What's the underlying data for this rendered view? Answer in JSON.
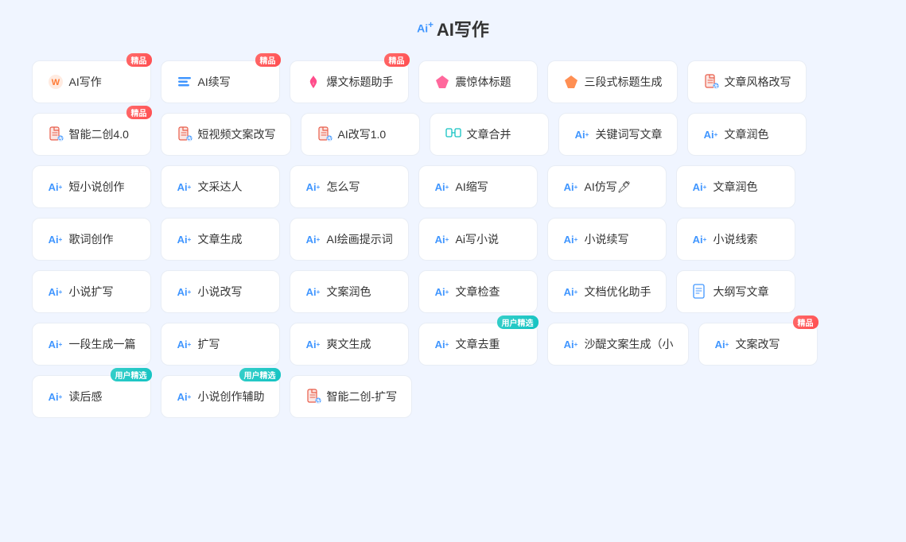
{
  "page": {
    "title": "AI写作",
    "title_prefix": "Ai⁺"
  },
  "rows": [
    {
      "cards": [
        {
          "id": "ai-writing",
          "icon_type": "circle-w",
          "icon_color": "c-orange",
          "label": "AI写作",
          "badge": "精品"
        },
        {
          "id": "ai-continue",
          "icon_type": "lines",
          "icon_color": "c-blue",
          "label": "AI续写",
          "badge": "精品"
        },
        {
          "id": "hot-title",
          "icon_type": "flame",
          "icon_color": "c-pink",
          "label": "爆文标题助手",
          "badge": "精品"
        },
        {
          "id": "shock-title",
          "icon_type": "diamond",
          "icon_color": "c-pink",
          "label": "震惊体标题",
          "badge": ""
        },
        {
          "id": "three-para-title",
          "icon_type": "diamond",
          "icon_color": "c-orange",
          "label": "三段式标题生成",
          "badge": ""
        },
        {
          "id": "style-rewrite",
          "icon_type": "doc",
          "icon_color": "c-red",
          "label": "文章风格改写",
          "badge": ""
        }
      ]
    },
    {
      "cards": [
        {
          "id": "smart-dual",
          "icon_type": "doc",
          "icon_color": "c-red",
          "label": "智能二创4.0",
          "badge": "精品"
        },
        {
          "id": "short-video",
          "icon_type": "doc",
          "icon_color": "c-red",
          "label": "短视频文案改写",
          "badge": ""
        },
        {
          "id": "ai-rewrite",
          "icon_type": "doc",
          "icon_color": "c-red",
          "label": "AI改写1.0",
          "badge": ""
        },
        {
          "id": "article-merge",
          "icon_type": "merge",
          "icon_color": "c-teal",
          "label": "文章合并",
          "badge": ""
        },
        {
          "id": "keyword-write",
          "icon_type": "ai-plus",
          "icon_color": "c-blue",
          "label": "关键词写文章",
          "badge": ""
        },
        {
          "id": "article-polish1",
          "icon_type": "ai-plus",
          "icon_color": "c-blue",
          "label": "文章润色",
          "badge": ""
        }
      ]
    },
    {
      "cards": [
        {
          "id": "short-novel",
          "icon_type": "ai-plus",
          "icon_color": "c-blue",
          "label": "短小说创作",
          "badge": ""
        },
        {
          "id": "writing-talent",
          "icon_type": "ai-plus",
          "icon_color": "c-blue",
          "label": "文采达人",
          "badge": ""
        },
        {
          "id": "how-to-write",
          "icon_type": "ai-plus",
          "icon_color": "c-blue",
          "label": "怎么写",
          "badge": ""
        },
        {
          "id": "ai-shrink",
          "icon_type": "ai-plus",
          "icon_color": "c-blue",
          "label": "AI缩写",
          "badge": ""
        },
        {
          "id": "ai-imitate",
          "icon_type": "ai-plus",
          "icon_color": "c-blue",
          "label": "AI仿写🖊",
          "badge": ""
        },
        {
          "id": "article-polish2",
          "icon_type": "ai-plus",
          "icon_color": "c-blue",
          "label": "文章润色",
          "badge": ""
        }
      ]
    },
    {
      "cards": [
        {
          "id": "lyric-create",
          "icon_type": "ai-plus",
          "icon_color": "c-blue",
          "label": "歌词创作",
          "badge": ""
        },
        {
          "id": "article-gen",
          "icon_type": "ai-plus",
          "icon_color": "c-blue",
          "label": "文章生成",
          "badge": ""
        },
        {
          "id": "ai-draw-prompt",
          "icon_type": "ai-plus",
          "icon_color": "c-blue",
          "label": "AI绘画提示词",
          "badge": ""
        },
        {
          "id": "ai-write-novel",
          "icon_type": "ai-plus",
          "icon_color": "c-blue",
          "label": "Ai写小说",
          "badge": ""
        },
        {
          "id": "novel-continue",
          "icon_type": "ai-plus",
          "icon_color": "c-blue",
          "label": "小说续写",
          "badge": ""
        },
        {
          "id": "novel-clue",
          "icon_type": "ai-plus",
          "icon_color": "c-blue",
          "label": "小说线索",
          "badge": ""
        }
      ]
    },
    {
      "cards": [
        {
          "id": "novel-expand",
          "icon_type": "ai-plus",
          "icon_color": "c-blue",
          "label": "小说扩写",
          "badge": ""
        },
        {
          "id": "novel-rewrite",
          "icon_type": "ai-plus",
          "icon_color": "c-blue",
          "label": "小说改写",
          "badge": ""
        },
        {
          "id": "copy-polish",
          "icon_type": "ai-plus",
          "icon_color": "c-blue",
          "label": "文案润色",
          "badge": ""
        },
        {
          "id": "article-check",
          "icon_type": "ai-plus",
          "icon_color": "c-blue",
          "label": "文章检查",
          "badge": ""
        },
        {
          "id": "doc-optimize",
          "icon_type": "ai-plus",
          "icon_color": "c-blue",
          "label": "文档优化助手",
          "badge": ""
        },
        {
          "id": "outline-write",
          "icon_type": "outline-doc",
          "icon_color": "c-blue",
          "label": "大纲写文章",
          "badge": ""
        }
      ]
    },
    {
      "cards": [
        {
          "id": "one-para-gen",
          "icon_type": "ai-plus",
          "icon_color": "c-blue",
          "label": "一段生成一篇",
          "badge": ""
        },
        {
          "id": "expand-write",
          "icon_type": "ai-plus",
          "icon_color": "c-blue",
          "label": "扩写",
          "badge": ""
        },
        {
          "id": "cool-gen",
          "icon_type": "ai-plus",
          "icon_color": "c-blue",
          "label": "爽文生成",
          "badge": ""
        },
        {
          "id": "article-dedup",
          "icon_type": "ai-plus",
          "icon_color": "c-blue",
          "label": "文章去重",
          "badge": "用户精选"
        },
        {
          "id": "sha-copy-gen",
          "icon_type": "ai-plus",
          "icon_color": "c-blue",
          "label": "沙醍文案生成（小",
          "badge": ""
        },
        {
          "id": "copy-rewrite",
          "icon_type": "ai-plus",
          "icon_color": "c-blue",
          "label": "文案改写",
          "badge": "精品"
        }
      ]
    },
    {
      "cards": [
        {
          "id": "read-feeling",
          "icon_type": "ai-plus",
          "icon_color": "c-blue",
          "label": "读后感",
          "badge": "用户精选"
        },
        {
          "id": "novel-assist",
          "icon_type": "ai-plus",
          "icon_color": "c-blue",
          "label": "小说创作辅助",
          "badge": "用户精选"
        },
        {
          "id": "smart-dual-expand",
          "icon_type": "doc",
          "icon_color": "c-red",
          "label": "智能二创-扩写",
          "badge": ""
        }
      ]
    }
  ]
}
